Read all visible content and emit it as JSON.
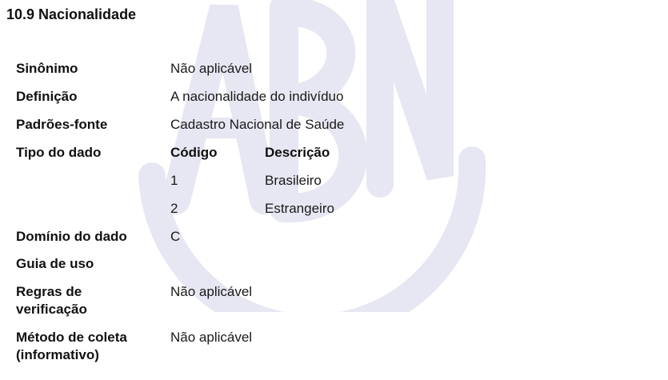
{
  "section": {
    "title": "10.9 Nacionalidade"
  },
  "watermark": {
    "color": "#e6e7f2"
  },
  "fields": {
    "sinonimo": {
      "label": "Sinônimo",
      "value": "Não aplicável"
    },
    "definicao": {
      "label": "Definição",
      "value": "A nacionalidade do indivíduo"
    },
    "padroes_fonte": {
      "label": "Padrões-fonte",
      "value": "Cadastro Nacional de Saúde"
    },
    "tipo_dado": {
      "label": "Tipo do dado",
      "header_codigo": "Código",
      "header_descricao": "Descrição",
      "rows": [
        {
          "codigo": "1",
          "descricao": "Brasileiro"
        },
        {
          "codigo": "2",
          "descricao": "Estrangeiro"
        }
      ]
    },
    "dominio": {
      "label": "Domínio do dado",
      "value": "C"
    },
    "guia_uso": {
      "label": "Guia de uso",
      "value": ""
    },
    "regras": {
      "label_line1": "Regras de",
      "label_line2": "verificação",
      "value": "Não aplicável"
    },
    "metodo": {
      "label_line1": "Método de coleta",
      "label_line2": "(informativo)",
      "value": "Não aplicável"
    }
  }
}
